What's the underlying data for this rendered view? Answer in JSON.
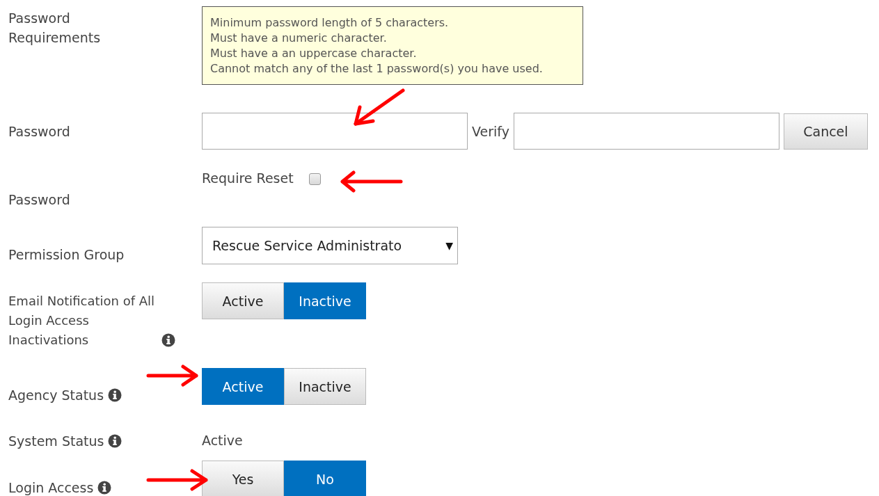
{
  "rows": [
    {
      "kind": "note",
      "label": "Password Requirements",
      "info": false,
      "lines": [
        "Minimum password length of 5 characters.",
        "Must have a numeric character.",
        "Must have a an uppercase character.",
        "Cannot match any of the last 1 password(s) you have used."
      ]
    },
    {
      "kind": "password_pair",
      "label": "Password",
      "info": false,
      "verify_label": "Verify",
      "cancel": "Cancel"
    },
    {
      "kind": "checkbox",
      "label": "Password",
      "info": false,
      "checkbox_label": "Require Reset",
      "checked": false
    },
    {
      "kind": "select",
      "label": "Permission Group",
      "info": false,
      "value": "Rescue Service Administrato",
      "caret": "▼"
    },
    {
      "kind": "toggle",
      "label": "Email Notification of All Login Access Inactivations",
      "info": true,
      "options": [
        {
          "label": "Active",
          "selected": false
        },
        {
          "label": "Inactive",
          "selected": true
        }
      ]
    },
    {
      "kind": "toggle",
      "label": "Agency Status",
      "info": true,
      "options": [
        {
          "label": "Active",
          "selected": true
        },
        {
          "label": "Inactive",
          "selected": false
        }
      ]
    },
    {
      "kind": "text",
      "label": "System Status",
      "info": true,
      "value": "Active"
    },
    {
      "kind": "toggle",
      "label": "Login Access",
      "info": true,
      "options": [
        {
          "label": "Yes",
          "selected": false
        },
        {
          "label": "No",
          "selected": true
        }
      ]
    }
  ]
}
